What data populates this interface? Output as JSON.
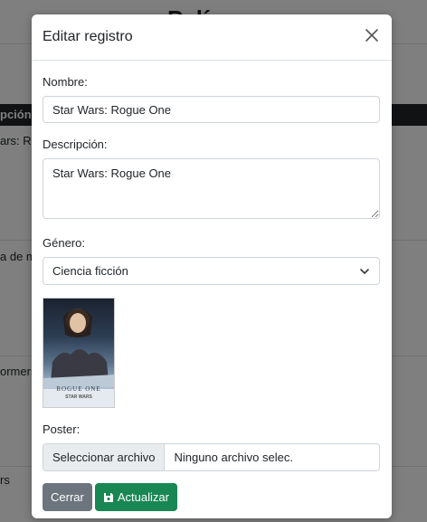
{
  "background": {
    "title": "Pelícu",
    "table_header": "pción",
    "rows": [
      "ars: Ro",
      "a de m",
      "ormers",
      "rs"
    ]
  },
  "modal": {
    "title": "Editar registro",
    "fields": {
      "nombre_label": "Nombre:",
      "nombre_value": "Star Wars: Rogue One",
      "descripcion_label": "Descripción:",
      "descripcion_value": "Star Wars: Rogue One",
      "genero_label": "Género:",
      "genero_value": "Ciencia ficción",
      "poster_label": "Poster:",
      "file_button_label": "Seleccionar archivo",
      "file_status": "Ninguno archivo selec."
    },
    "poster_image": {
      "title_text": "ROGUE ONE",
      "subtitle_text": "STAR WARS"
    },
    "buttons": {
      "close_label": "Cerrar",
      "update_label": "Actualizar"
    }
  },
  "colors": {
    "primary_dark": "#212529",
    "secondary": "#6c757d",
    "success": "#198754",
    "border": "#ced4da"
  },
  "icons": {
    "close": "close-icon",
    "dropdown": "chevron-down-icon",
    "save": "save-icon"
  }
}
